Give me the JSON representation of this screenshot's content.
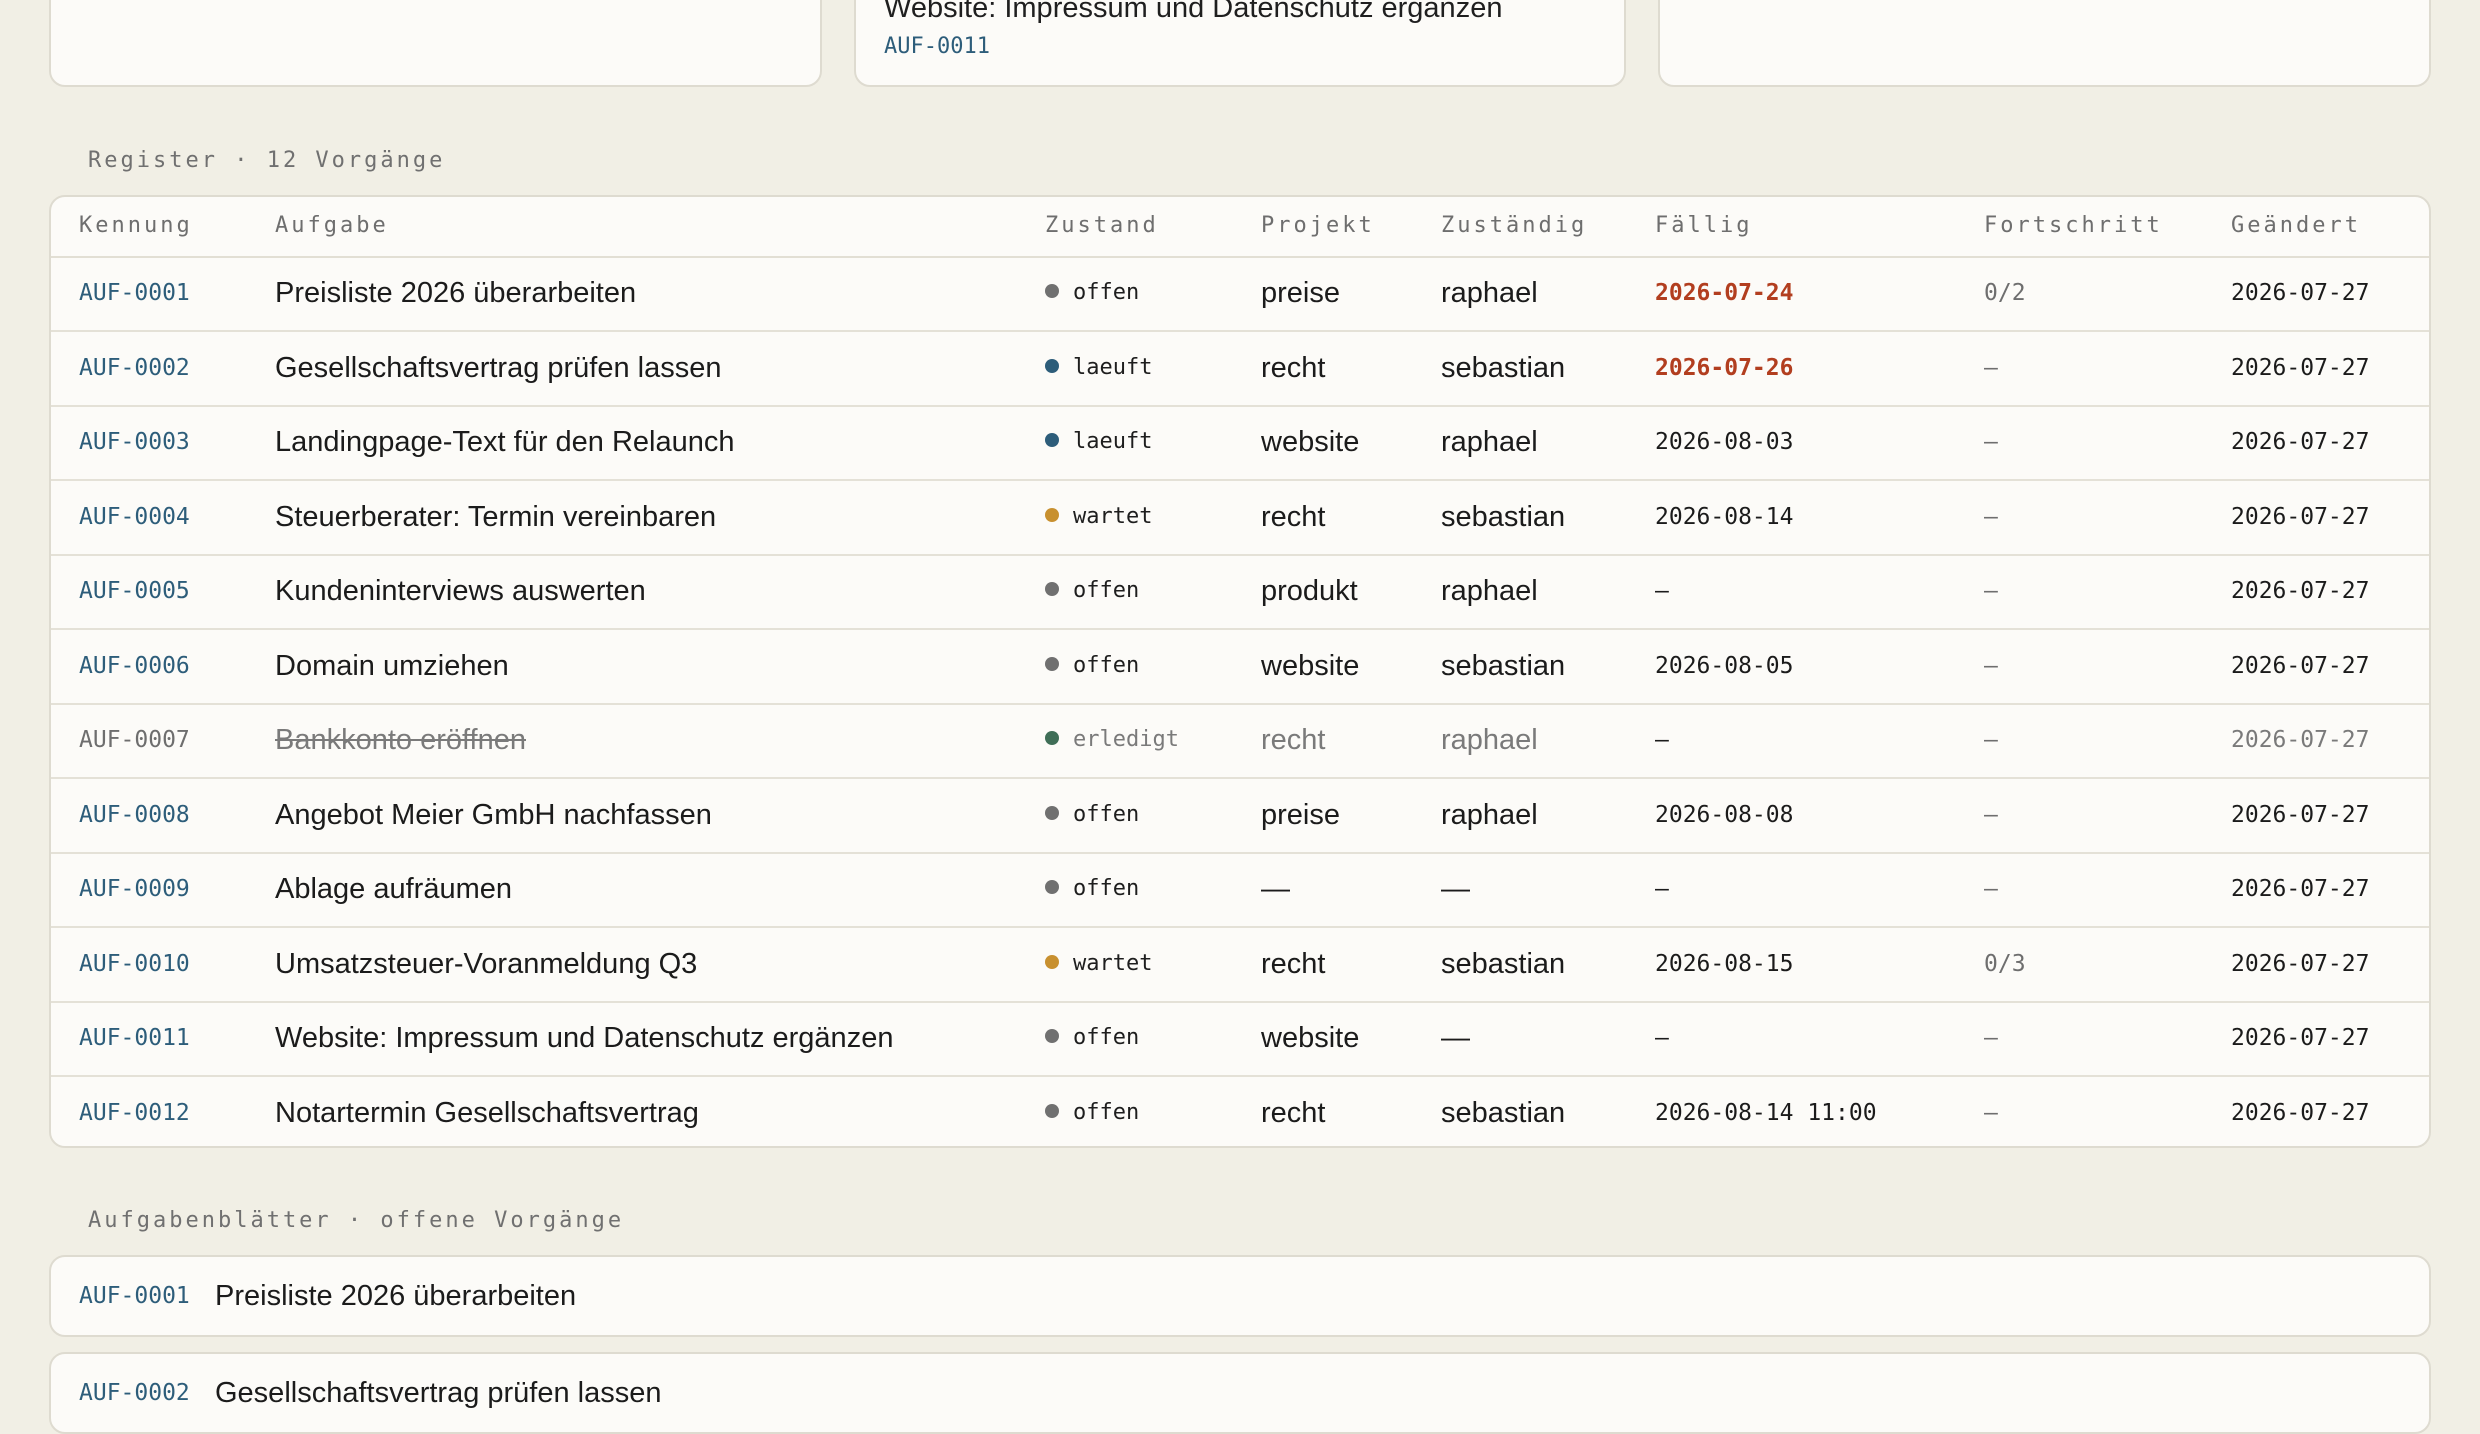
{
  "top_cards": [
    {
      "title": "",
      "id": ""
    },
    {
      "title": "Website: Impressum und Datenschutz ergänzen",
      "id": "AUF-0011"
    },
    {
      "title": "",
      "id": ""
    }
  ],
  "register": {
    "label": "Register · 12 Vorgänge",
    "columns": [
      "Kennung",
      "Aufgabe",
      "Zustand",
      "Projekt",
      "Zuständig",
      "Fällig",
      "Fortschritt",
      "Geändert"
    ],
    "status_colors": {
      "offen": "#707070",
      "laeuft": "#2d5d7a",
      "wartet": "#c8902f",
      "erledigt": "#3f6e57"
    },
    "overdue_color": "#b23e1f",
    "rows": [
      {
        "id": "AUF-0001",
        "task": "Preisliste 2026 überarbeiten",
        "state": "offen",
        "project": "preise",
        "owner": "raphael",
        "due": "2026-07-24",
        "overdue": true,
        "progress": "0/2",
        "changed": "2026-07-27"
      },
      {
        "id": "AUF-0002",
        "task": "Gesellschaftsvertrag prüfen lassen",
        "state": "laeuft",
        "project": "recht",
        "owner": "sebastian",
        "due": "2026-07-26",
        "overdue": true,
        "progress": "—",
        "changed": "2026-07-27"
      },
      {
        "id": "AUF-0003",
        "task": "Landingpage-Text für den Relaunch",
        "state": "laeuft",
        "project": "website",
        "owner": "raphael",
        "due": "2026-08-03",
        "overdue": false,
        "progress": "—",
        "changed": "2026-07-27"
      },
      {
        "id": "AUF-0004",
        "task": "Steuerberater: Termin vereinbaren",
        "state": "wartet",
        "project": "recht",
        "owner": "sebastian",
        "due": "2026-08-14",
        "overdue": false,
        "progress": "—",
        "changed": "2026-07-27"
      },
      {
        "id": "AUF-0005",
        "task": "Kundeninterviews auswerten",
        "state": "offen",
        "project": "produkt",
        "owner": "raphael",
        "due": "—",
        "overdue": false,
        "progress": "—",
        "changed": "2026-07-27"
      },
      {
        "id": "AUF-0006",
        "task": "Domain umziehen",
        "state": "offen",
        "project": "website",
        "owner": "sebastian",
        "due": "2026-08-05",
        "overdue": false,
        "progress": "—",
        "changed": "2026-07-27"
      },
      {
        "id": "AUF-0007",
        "task": "Bankkonto eröffnen",
        "state": "erledigt",
        "project": "recht",
        "owner": "raphael",
        "due": "—",
        "overdue": false,
        "progress": "—",
        "changed": "2026-07-27",
        "done": true
      },
      {
        "id": "AUF-0008",
        "task": "Angebot Meier GmbH nachfassen",
        "state": "offen",
        "project": "preise",
        "owner": "raphael",
        "due": "2026-08-08",
        "overdue": false,
        "progress": "—",
        "changed": "2026-07-27"
      },
      {
        "id": "AUF-0009",
        "task": "Ablage aufräumen",
        "state": "offen",
        "project": "—",
        "owner": "—",
        "due": "—",
        "overdue": false,
        "progress": "—",
        "changed": "2026-07-27"
      },
      {
        "id": "AUF-0010",
        "task": "Umsatzsteuer-Voranmeldung Q3",
        "state": "wartet",
        "project": "recht",
        "owner": "sebastian",
        "due": "2026-08-15",
        "overdue": false,
        "progress": "0/3",
        "changed": "2026-07-27"
      },
      {
        "id": "AUF-0011",
        "task": "Website: Impressum und Datenschutz ergänzen",
        "state": "offen",
        "project": "website",
        "owner": "—",
        "due": "—",
        "overdue": false,
        "progress": "—",
        "changed": "2026-07-27"
      },
      {
        "id": "AUF-0012",
        "task": "Notartermin Gesellschaftsvertrag",
        "state": "offen",
        "project": "recht",
        "owner": "sebastian",
        "due": "2026-08-14 11:00",
        "overdue": false,
        "progress": "—",
        "changed": "2026-07-27"
      }
    ]
  },
  "sheets": {
    "label": "Aufgabenblätter · offene Vorgänge",
    "items": [
      {
        "id": "AUF-0001",
        "title": "Preisliste 2026 überarbeiten"
      },
      {
        "id": "AUF-0002",
        "title": "Gesellschaftsvertrag prüfen lassen"
      }
    ]
  }
}
